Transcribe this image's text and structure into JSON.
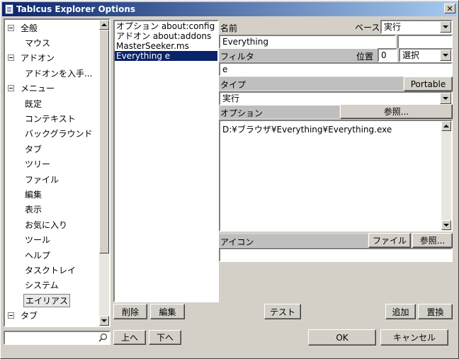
{
  "window": {
    "title": "Tablcus Explorer Options"
  },
  "tree": {
    "items": [
      {
        "label": "全般",
        "type": "group"
      },
      {
        "label": "マウス",
        "type": "child"
      },
      {
        "label": "アドオン",
        "type": "group"
      },
      {
        "label": "アドオンを入手...",
        "type": "child"
      },
      {
        "label": "メニュー",
        "type": "group"
      },
      {
        "label": "既定",
        "type": "child"
      },
      {
        "label": "コンテキスト",
        "type": "child"
      },
      {
        "label": "バックグラウンド",
        "type": "child"
      },
      {
        "label": "タブ",
        "type": "child"
      },
      {
        "label": "ツリー",
        "type": "child"
      },
      {
        "label": "ファイル",
        "type": "child"
      },
      {
        "label": "編集",
        "type": "child"
      },
      {
        "label": "表示",
        "type": "child"
      },
      {
        "label": "お気に入り",
        "type": "child"
      },
      {
        "label": "ツール",
        "type": "child"
      },
      {
        "label": "ヘルプ",
        "type": "child"
      },
      {
        "label": "タスクトレイ",
        "type": "child"
      },
      {
        "label": "システム",
        "type": "child"
      },
      {
        "label": "エイリアス",
        "type": "child"
      },
      {
        "label": "タブ",
        "type": "group"
      }
    ]
  },
  "alias_list": {
    "items": [
      {
        "text": "オプション about:config",
        "selected": false
      },
      {
        "text": "アドオン about:addons",
        "selected": false
      },
      {
        "text": "MasterSeeker.ms",
        "selected": false
      },
      {
        "text": "Everything e",
        "selected": true
      }
    ]
  },
  "form": {
    "name_label": "名前",
    "base_label": "ベース",
    "base_value": "実行",
    "name_value": "Everything",
    "filter_label": "フィルタ",
    "position_label": "位置",
    "position_value": "0",
    "select_value": "選択",
    "filter_value": "e",
    "type_label": "タイプ",
    "portable_button": "Portable",
    "type_value": "実行",
    "option_label": "オプション",
    "browse_button": "参照...",
    "option_value": "D:¥ブラウザ¥Everything¥Everything.exe",
    "icon_label": "アイコン",
    "file_button": "ファイル",
    "icon_browse_button": "参照..."
  },
  "buttons": {
    "delete": "削除",
    "edit": "編集",
    "test": "テスト",
    "add": "追加",
    "replace": "置換",
    "up": "上へ",
    "down": "下へ",
    "ok": "OK",
    "cancel": "キャンセル"
  },
  "colors": {
    "selection": "#0a246a",
    "face": "#d4d0c8"
  }
}
